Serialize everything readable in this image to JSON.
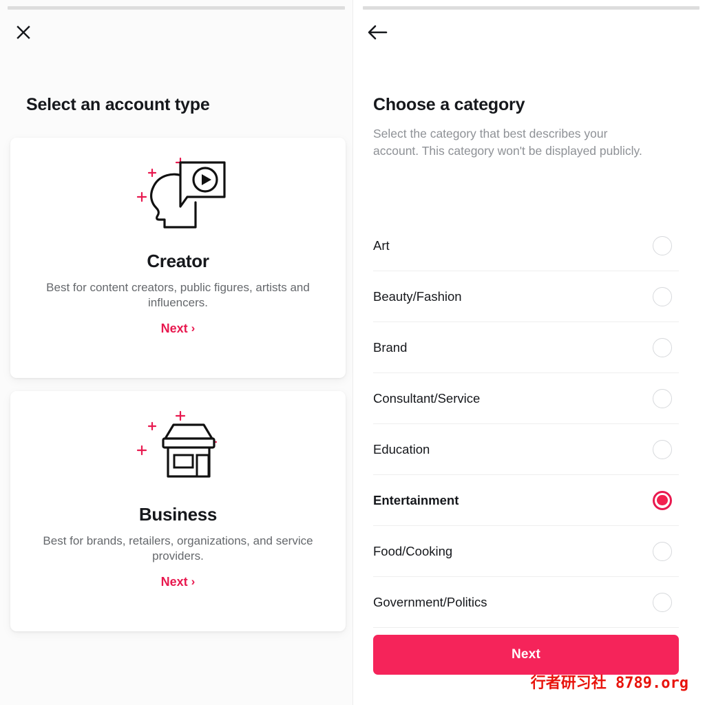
{
  "colors": {
    "accent_pink": "#e8194f",
    "button_pink": "#f5245a",
    "radio_fill": "#f2214f",
    "text_dark": "#16181c",
    "text_muted": "#8e9196",
    "divider": "#eeeeee",
    "progress_track": "#dddddd",
    "watermark_red": "#e8140d"
  },
  "left_panel": {
    "close_icon": "close-x-icon",
    "title": "Select an account type",
    "cards": [
      {
        "icon": "creator-head-video-icon",
        "title": "Creator",
        "description": "Best for content creators, public figures, artists and influencers.",
        "next_label": "Next",
        "next_chevron": "›"
      },
      {
        "icon": "business-storefront-icon",
        "title": "Business",
        "description": "Best for brands, retailers, organizations, and service providers.",
        "next_label": "Next",
        "next_chevron": "›"
      }
    ]
  },
  "right_panel": {
    "back_icon": "arrow-left-icon",
    "title": "Choose a category",
    "subtitle": "Select the category that best describes your account. This category won't be displayed publicly.",
    "categories": [
      {
        "label": "Art",
        "selected": false
      },
      {
        "label": "Beauty/Fashion",
        "selected": false
      },
      {
        "label": "Brand",
        "selected": false
      },
      {
        "label": "Consultant/Service",
        "selected": false
      },
      {
        "label": "Education",
        "selected": false
      },
      {
        "label": "Entertainment",
        "selected": true
      },
      {
        "label": "Food/Cooking",
        "selected": false
      },
      {
        "label": "Government/Politics",
        "selected": false
      }
    ],
    "primary_button": "Next"
  },
  "watermark": "行者研习社 8789.org"
}
